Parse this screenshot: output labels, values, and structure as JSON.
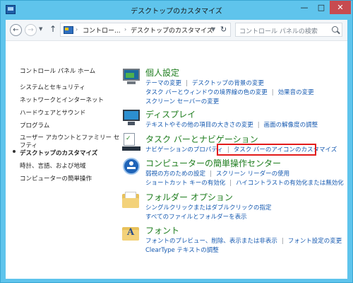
{
  "window": {
    "title": "デスクトップのカスタマイズ",
    "minimize_glyph": "—",
    "maximize_glyph": "□",
    "close_glyph": "✕"
  },
  "addressbar": {
    "back_glyph": "←",
    "forward_glyph": "→",
    "recent_glyph": "▼",
    "up_glyph": "↑",
    "separator_glyph": "›",
    "breadcrumb": [
      "コントロー...",
      "デスクトップのカスタマイズ"
    ],
    "dropdown_glyph": "▼",
    "refresh_glyph": "↻",
    "search_placeholder": "コントロール パネルの検索"
  },
  "sidebar": {
    "home": "コントロール パネル ホーム",
    "items": [
      "システムとセキュリティ",
      "ネットワークとインターネット",
      "ハードウェアとサウンド",
      "プログラム",
      "ユーザー アカウントとファミリー セ",
      "フティ",
      "デスクトップのカスタマイズ",
      "時計、言語、および地域",
      "コンピューターの簡単操作"
    ]
  },
  "categories": [
    {
      "icon": "appearance-icon",
      "title": "個人設定",
      "links": [
        [
          "テーマの変更",
          "デスクトップの背景の変更"
        ],
        [
          "タスク バーとウィンドウの境界線の色の変更",
          "効果音の変更"
        ],
        [
          "スクリーン セーバーの変更"
        ]
      ]
    },
    {
      "icon": "display-icon",
      "title": "ディスプレイ",
      "links": [
        [
          "テキストやその他の項目の大きさの変更",
          "画面の解像度の調整"
        ]
      ]
    },
    {
      "icon": "taskbar-icon",
      "title": "タスク バーとナビゲーション",
      "links": [
        [
          "ナビゲーションのプロパティ",
          "タスク バーのアイコンのカスタマイズ"
        ]
      ]
    },
    {
      "icon": "ease-of-access-icon",
      "title": "コンピューターの簡単操作センター",
      "links": [
        [
          "弱視の方のための設定",
          "スクリーン リーダーの使用"
        ],
        [
          "ショートカット キーの有効化",
          "ハイコントラストの有効化または無効化"
        ]
      ]
    },
    {
      "icon": "folder-options-icon",
      "title": "フォルダー オプション",
      "links": [
        [
          "シングルクリックまたはダブルクリックの指定"
        ],
        [
          "すべてのファイルとフォルダーを表示"
        ]
      ]
    },
    {
      "icon": "font-icon",
      "title": "フォント",
      "glyph": "A",
      "links": [
        [
          "フォントのプレビュー、削除、表示または非表示",
          "フォント設定の変更"
        ],
        [
          "ClearType テキストの調整"
        ]
      ]
    }
  ],
  "colors": {
    "frame": "#5fc4ec",
    "category_title": "#1e7d1e",
    "link": "#1559b0",
    "highlight_box": "#e21a1a"
  }
}
